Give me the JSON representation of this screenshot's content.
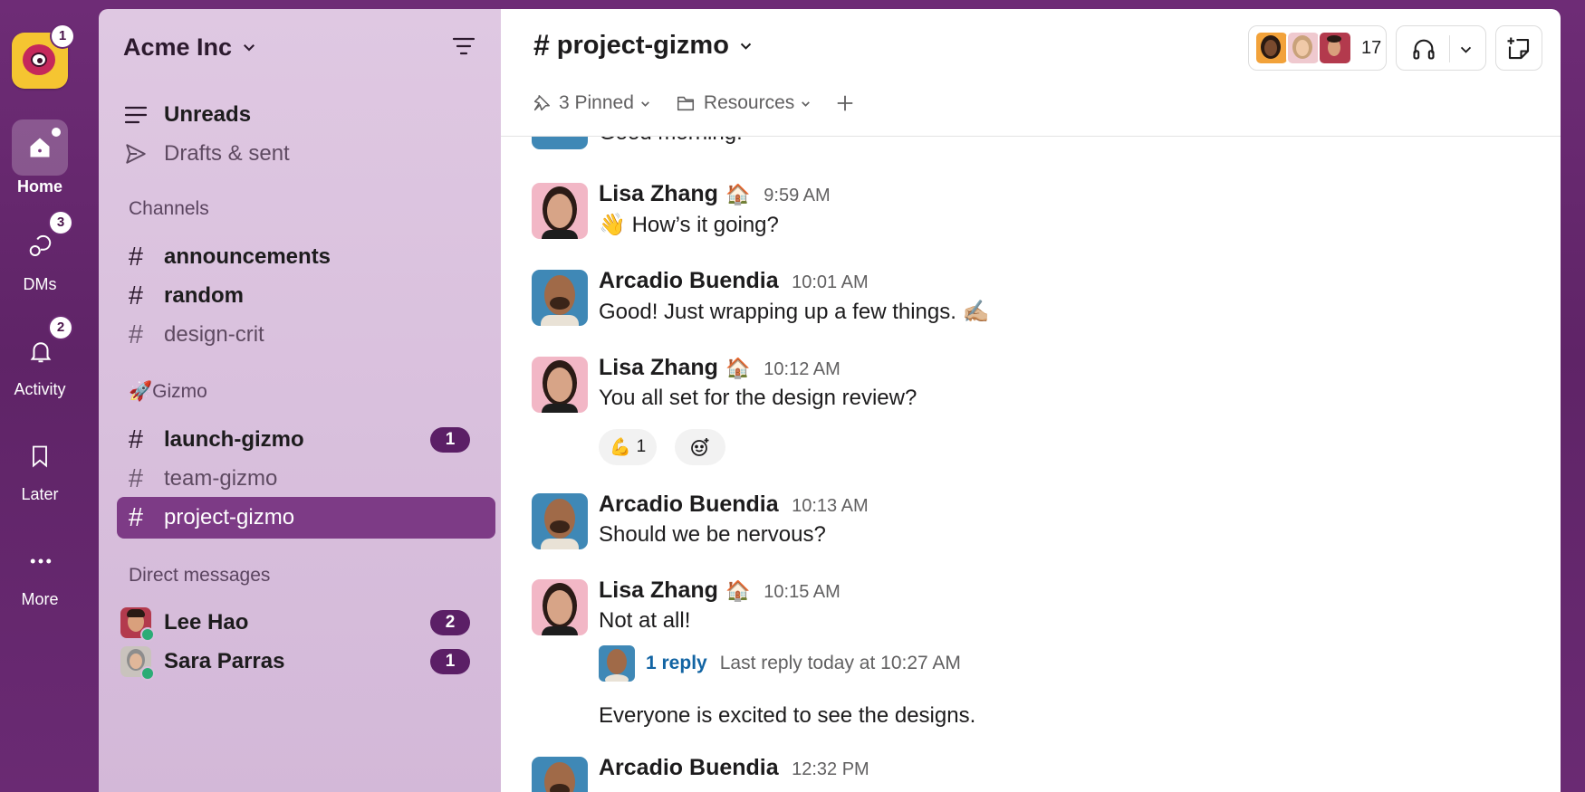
{
  "rail": {
    "workspace_badge": "1",
    "items": [
      {
        "label": "Home",
        "icon": "home-icon",
        "badge": ""
      },
      {
        "label": "DMs",
        "icon": "dms-icon",
        "badge": "3"
      },
      {
        "label": "Activity",
        "icon": "bell-icon",
        "badge": "2"
      },
      {
        "label": "Later",
        "icon": "bookmark-icon",
        "badge": ""
      },
      {
        "label": "More",
        "icon": "more-icon",
        "badge": ""
      }
    ]
  },
  "sidebar": {
    "workspace": "Acme Inc",
    "top": [
      {
        "label": "Unreads",
        "icon": "unreads-icon"
      },
      {
        "label": "Drafts & sent",
        "icon": "send-icon"
      }
    ],
    "sections": {
      "channels": {
        "title": "Channels",
        "items": [
          {
            "label": "announcements",
            "unread": true
          },
          {
            "label": "random",
            "unread": true
          },
          {
            "label": "design-crit",
            "unread": false
          }
        ]
      },
      "gizmo": {
        "emoji": "🚀",
        "title": "Gizmo",
        "items": [
          {
            "label": "launch-gizmo",
            "unread": true,
            "count": "1"
          },
          {
            "label": "team-gizmo",
            "unread": false
          },
          {
            "label": "project-gizmo",
            "selected": true
          }
        ]
      },
      "dms": {
        "title": "Direct messages",
        "items": [
          {
            "label": "Lee Hao",
            "count": "2"
          },
          {
            "label": "Sara Parras",
            "count": "1"
          }
        ]
      }
    }
  },
  "channel": {
    "name": "project-gizmo",
    "member_count": "17",
    "bookmarks": {
      "pinned": "3 Pinned",
      "resources": "Resources"
    }
  },
  "messages": {
    "partial": "Good morning!",
    "m1": {
      "author": "Lisa Zhang",
      "status": "🏠",
      "time": "9:59 AM",
      "emoji": "👋",
      "text": "How’s it going?"
    },
    "m2": {
      "author": "Arcadio Buendia",
      "time": "10:01 AM",
      "text": "Good! Just wrapping up a few things.",
      "emoji": "✍🏼"
    },
    "m3": {
      "author": "Lisa Zhang",
      "status": "🏠",
      "time": "10:12 AM",
      "text": "You all set for the design review?",
      "reaction": {
        "emoji": "💪",
        "count": "1"
      }
    },
    "m4": {
      "author": "Arcadio Buendia",
      "time": "10:13 AM",
      "text": "Should we be nervous?"
    },
    "m5": {
      "author": "Lisa Zhang",
      "status": "🏠",
      "time": "10:15 AM",
      "text": "Not at all!",
      "thread": {
        "replies": "1 reply",
        "last": "Last reply today at 10:27 AM"
      },
      "followup": "Everyone is excited to see the designs."
    },
    "m6": {
      "author": "Arcadio Buendia",
      "time": "12:32 PM"
    }
  },
  "colors": {
    "aubergine": "#4a154b",
    "selected": "#7d3b86",
    "link": "#1264a3"
  }
}
